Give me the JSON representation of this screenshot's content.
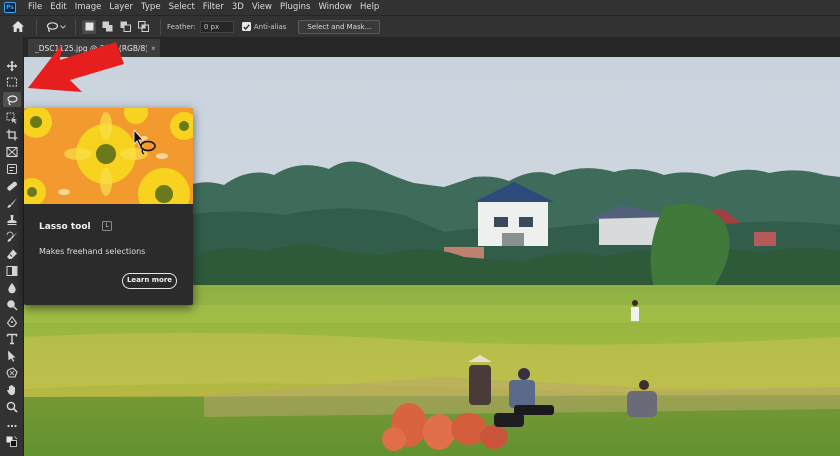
{
  "app": {
    "logo_text": "Ps"
  },
  "menu": [
    "File",
    "Edit",
    "Image",
    "Layer",
    "Type",
    "Select",
    "Filter",
    "3D",
    "View",
    "Plugins",
    "Window",
    "Help"
  ],
  "options_bar": {
    "feather_label": "Feather:",
    "feather_value": "0 px",
    "anti_alias_label": "Anti-alias",
    "anti_alias_checked": true,
    "select_mask_label": "Select and Mask..."
  },
  "document_tab": {
    "title": "_DSC1125.jpg @ 25% (RGB/8)",
    "close_symbol": "×"
  },
  "toolbar": {
    "tools": [
      "move-icon",
      "marquee-icon",
      "lasso-icon",
      "object-select-icon",
      "crop-icon",
      "frame-icon",
      "eyedropper-icon",
      "healing-icon",
      "brush-icon",
      "stamp-icon",
      "history-brush-icon",
      "eraser-icon",
      "gradient-icon",
      "blur-icon",
      "dodge-icon",
      "pen-icon",
      "type-icon",
      "path-select-icon",
      "shape-icon",
      "hand-icon",
      "zoom-icon",
      "more-icon",
      "swap-colors-icon"
    ],
    "active_tool": "lasso-icon"
  },
  "tooltip": {
    "title": "Lasso tool",
    "shortcut": "L",
    "description": "Makes freehand selections",
    "learn_more_label": "Learn more"
  },
  "colors": {
    "accent_red": "#e61e1e",
    "ps_blue": "#31a8ff",
    "tooltip_bg": "#2b2b2b",
    "panel_bg": "#323232"
  }
}
